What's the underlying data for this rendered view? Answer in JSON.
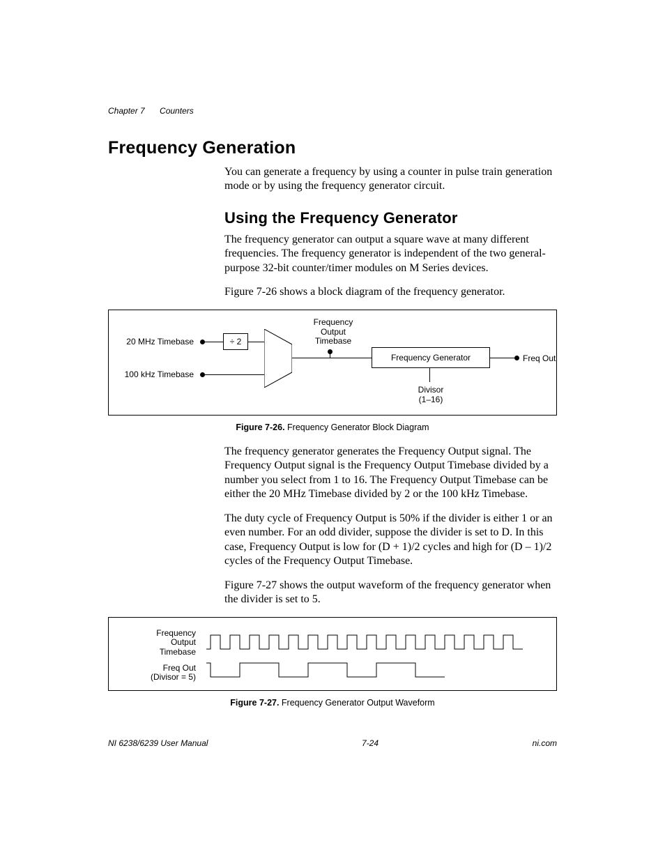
{
  "header": {
    "chapter": "Chapter 7",
    "section": "Counters"
  },
  "h1": "Frequency Generation",
  "p1": "You can generate a frequency by using a counter in pulse train generation mode or by using the frequency generator circuit.",
  "h2": "Using the Frequency Generator",
  "p2": "The frequency generator can output a square wave at many different frequencies. The frequency generator is independent of the two general-purpose 32-bit counter/timer modules on M Series devices.",
  "p3": "Figure 7-26 shows a block diagram of the frequency generator.",
  "fig26": {
    "in1": "20 MHz Timebase",
    "in2": "100 kHz Timebase",
    "div2": "÷ 2",
    "tb_top": "Frequency",
    "tb_mid": "Output",
    "tb_bot": "Timebase",
    "gen": "Frequency Generator",
    "out": "Freq Out",
    "divisor1": "Divisor",
    "divisor2": "(1–16)",
    "cap_b": "Figure 7-26.",
    "cap_t": "  Frequency Generator Block Diagram"
  },
  "p4": "The frequency generator generates the Frequency Output signal. The Frequency Output signal is the Frequency Output Timebase divided by a number you select from 1 to 16. The Frequency Output Timebase can be either the 20 MHz Timebase divided by 2 or the 100 kHz Timebase.",
  "p5": "The duty cycle of Frequency Output is 50% if the divider is either 1 or an even number. For an odd divider, suppose the divider is set to D. In this case, Frequency Output is low for (D + 1)/2 cycles and high for (D – 1)/2 cycles of the Frequency Output Timebase.",
  "p6": "Figure 7-27 shows the output waveform of the frequency generator when the divider is set to 5.",
  "fig27": {
    "lbl1a": "Frequency",
    "lbl1b": "Output",
    "lbl1c": "Timebase",
    "lbl2a": "Freq Out",
    "lbl2b": "(Divisor = 5)",
    "cap_b": "Figure 7-27.",
    "cap_t": "  Frequency Generator Output Waveform"
  },
  "footer": {
    "left": "NI 6238/6239 User Manual",
    "center": "7-24",
    "right": "ni.com"
  }
}
